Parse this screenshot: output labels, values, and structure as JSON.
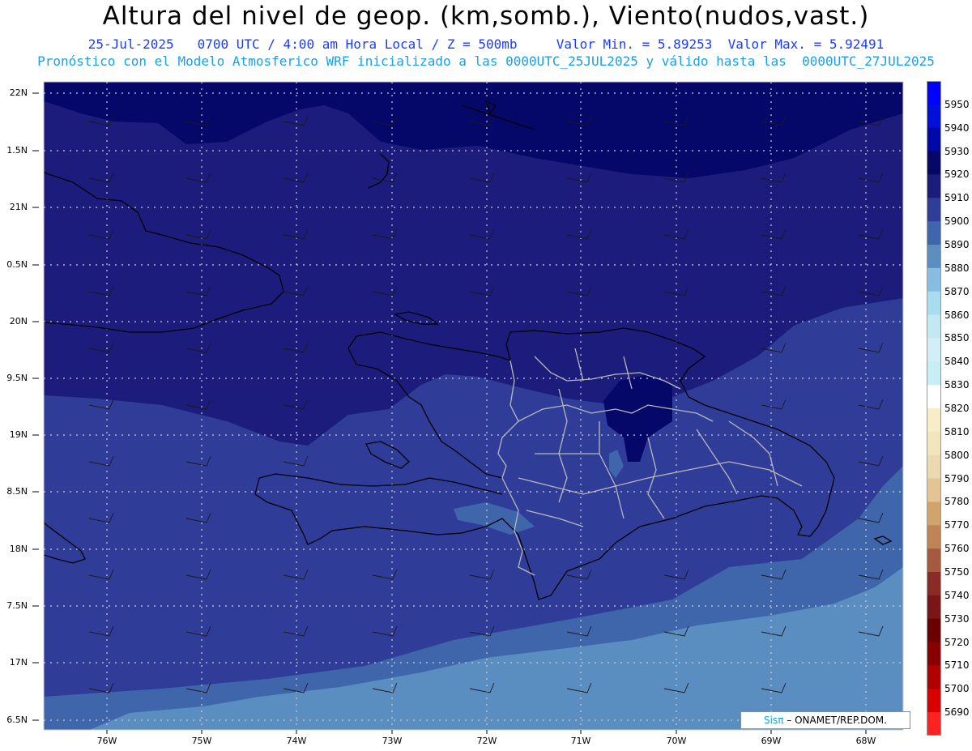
{
  "header": {
    "title": "Altura del nivel de geop. (km,somb.), Viento(nudos,vast.)",
    "line1": "25-Jul-2025   0700 UTC / 4:00 am Hora Local / Z = 500mb     Valor Min. = 5.89253  Valor Max. = 5.92491",
    "line2": "Pronóstico con el Modelo Atmosferico WRF inicializado a las 0000UTC_25JUL2025 y válido hasta las  0000UTC_27JUL2025"
  },
  "axes": {
    "lat_labels": [
      "22N",
      "1.5N",
      "21N",
      "0.5N",
      "20N",
      "9.5N",
      "19N",
      "8.5N",
      "18N",
      "7.5N",
      "17N",
      "6.5N"
    ],
    "lon_labels": [
      "76W",
      "75W",
      "74W",
      "73W",
      "72W",
      "71W",
      "70W",
      "69W",
      "68W"
    ]
  },
  "legend": {
    "levels": [
      "5950",
      "5940",
      "5930",
      "5920",
      "5910",
      "5900",
      "5890",
      "5880",
      "5870",
      "5860",
      "5850",
      "5840",
      "5830",
      "5820",
      "5810",
      "5800",
      "5790",
      "5780",
      "5770",
      "5760",
      "5750",
      "5740",
      "5730",
      "5720",
      "5710",
      "5700",
      "5690"
    ],
    "colors": [
      "#0000ff",
      "#0010d8",
      "#0008a8",
      "#050868",
      "#1c1c7c",
      "#2f3d99",
      "#3f65aa",
      "#5a8dc0",
      "#87bde0",
      "#a9dcef",
      "#c2e9f3",
      "#d2eef6",
      "#c8eef5",
      "#ffffff",
      "#f7edc8",
      "#f2e4bd",
      "#ecd9b1",
      "#e3c594",
      "#d2a46d",
      "#bf8456",
      "#a55a3f",
      "#8a2b27",
      "#7a1519",
      "#6a0000",
      "#8a0000",
      "#b00000",
      "#d80000",
      "#ff2222"
    ]
  },
  "credit": {
    "brand": "Sisπ",
    "text": " – ONAMET/REP.DOM."
  },
  "colors": {
    "shade_5910": "#1c1c7c",
    "shade_5920": "#050868",
    "shade_5900": "#2f3d99",
    "shade_5890": "#3f65aa",
    "shade_5880": "#5a8dc0",
    "grid": "#d0d0d0",
    "coast": "#000000",
    "borders": "#b8b8b8"
  }
}
